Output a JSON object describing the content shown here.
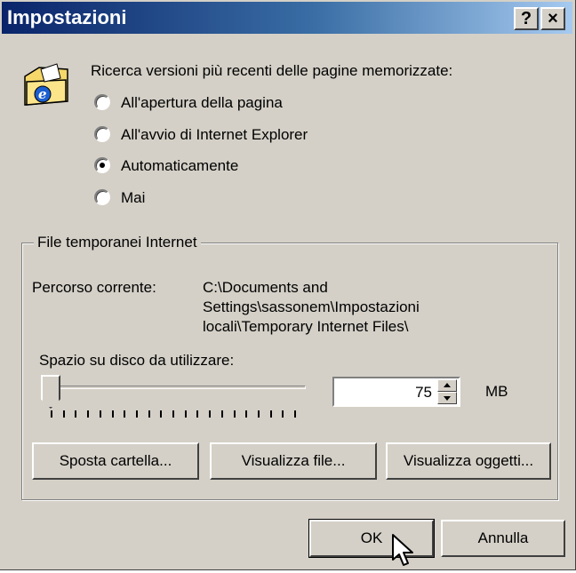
{
  "window": {
    "title": "Impostazioni",
    "help_button": "?",
    "close_button": "×"
  },
  "check_section": {
    "prompt": "Ricerca versioni più recenti delle pagine memorizzate:",
    "options": [
      {
        "label": "All'apertura della pagina",
        "selected": false
      },
      {
        "label": "All'avvio di Internet Explorer",
        "selected": false
      },
      {
        "label": "Automaticamente",
        "selected": true
      },
      {
        "label": "Mai",
        "selected": false
      }
    ]
  },
  "temp_files": {
    "group_label": "File temporanei Internet",
    "path_label": "Percorso corrente:",
    "path_lines": [
      "C:\\Documents and",
      "Settings\\sassonem\\Impostazioni",
      "locali\\Temporary Internet Files\\"
    ],
    "disk_label": "Spazio su disco da utilizzare:",
    "disk_value": "75",
    "unit": "MB",
    "slider_level": 0.02,
    "buttons": {
      "move": "Sposta cartella...",
      "view_files": "Visualizza file...",
      "view_objects": "Visualizza oggetti..."
    }
  },
  "footer": {
    "ok": "OK",
    "cancel": "Annulla"
  }
}
